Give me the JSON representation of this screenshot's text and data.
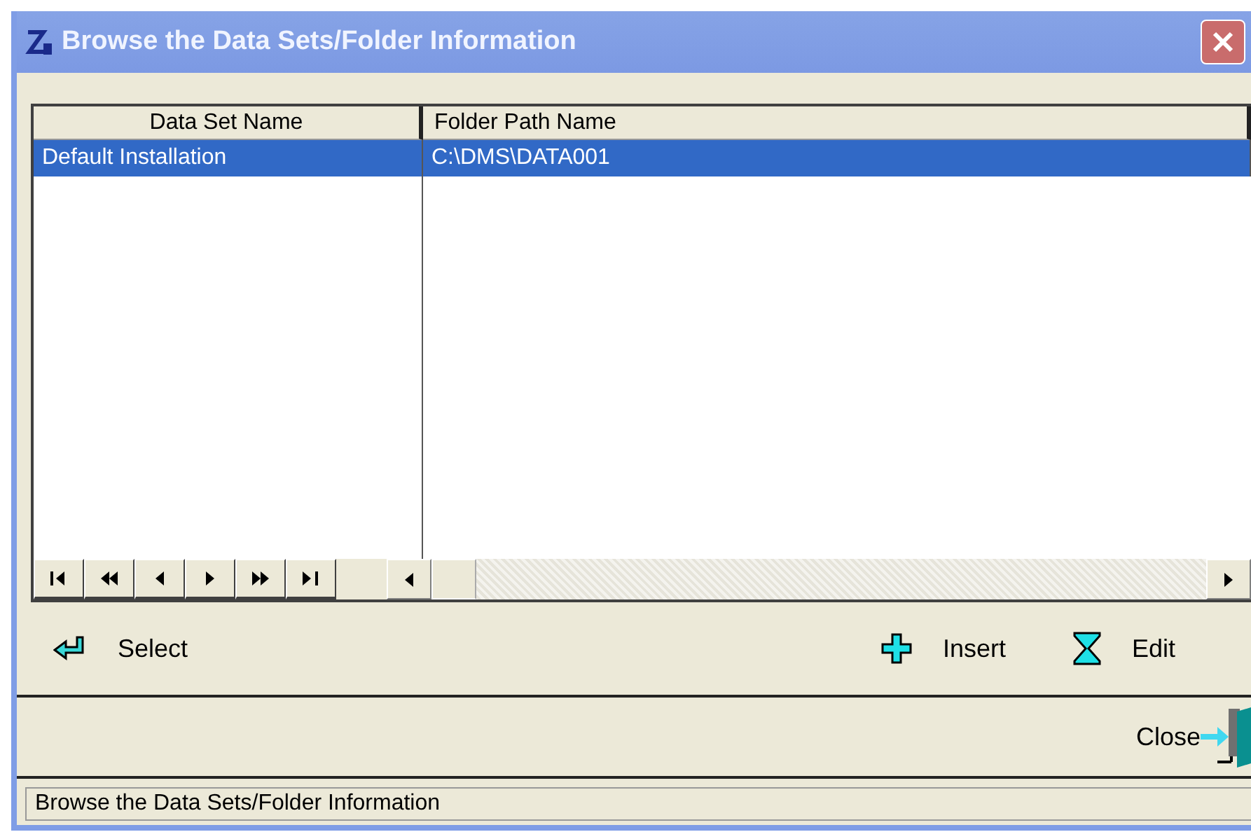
{
  "window": {
    "title": "Browse the Data Sets/Folder Information"
  },
  "table": {
    "columns": [
      "Data Set Name",
      "Folder Path Name"
    ],
    "rows": [
      {
        "cells": [
          "Default Installation",
          "C:\\DMS\\DATA001"
        ],
        "selected": true
      }
    ]
  },
  "actions": {
    "left": [
      {
        "label": "Select",
        "kind": "select"
      }
    ],
    "right": [
      {
        "label": "Insert",
        "kind": "insert"
      },
      {
        "label": "Edit",
        "kind": "edit"
      }
    ]
  },
  "close_button": {
    "label": "Close"
  },
  "status_bar": "Browse the Data Sets/Folder Information"
}
